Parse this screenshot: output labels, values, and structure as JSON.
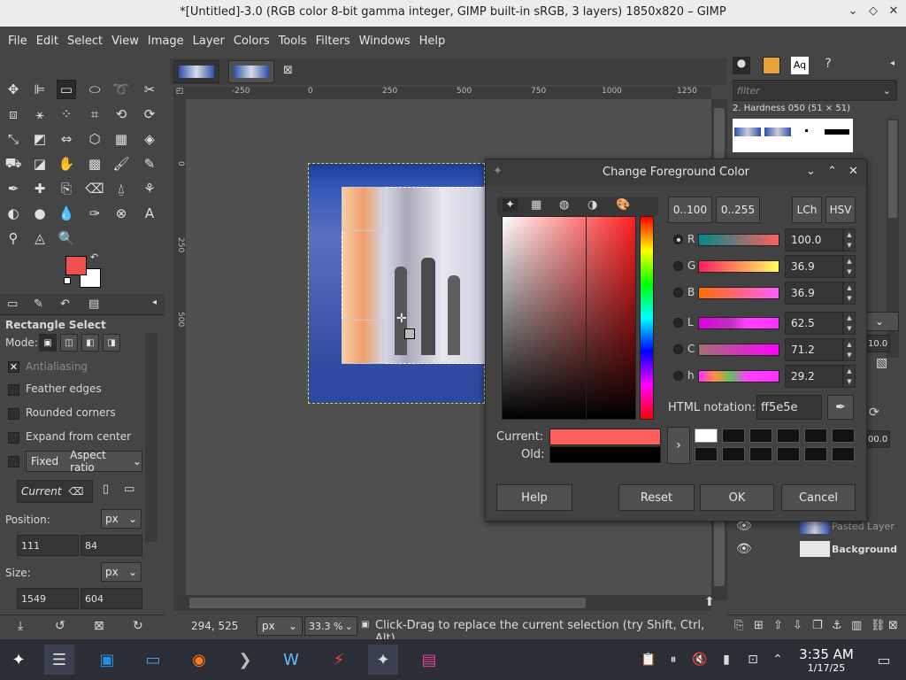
{
  "window": {
    "title": "*[Untitled]-3.0 (RGB color 8-bit gamma integer, GIMP built-in sRGB, 3 layers) 1850x820 – GIMP"
  },
  "menu": [
    "File",
    "Edit",
    "Select",
    "View",
    "Image",
    "Layer",
    "Colors",
    "Tools",
    "Filters",
    "Windows",
    "Help"
  ],
  "tool_options": {
    "title": "Rectangle Select",
    "mode_label": "Mode:",
    "antialiasing": "Antialiasing",
    "feather_edges": "Feather edges",
    "rounded_corners": "Rounded corners",
    "expand_from_center": "Expand from center",
    "fixed_label": "Fixed",
    "fixed_value": "Aspect ratio",
    "current_value": "Current",
    "position_label": "Position:",
    "position_unit": "px",
    "pos_x": "111",
    "pos_y": "84",
    "size_label": "Size:",
    "size_unit": "px",
    "size_w": "1549",
    "size_h": "604"
  },
  "canvas": {
    "ruler_marks": [
      "-250",
      "0",
      "250",
      "500",
      "750",
      "1000",
      "1250"
    ],
    "ruler_left": [
      "0",
      "250",
      "500"
    ],
    "coords": "294, 525",
    "unit": "px",
    "zoom": "33.3 %",
    "status": "Click-Drag to replace the current selection (try Shift, Ctrl, Alt)"
  },
  "right_dock": {
    "filter_placeholder": "filter",
    "brush_name": "2. Hardness 050 (51 × 51)",
    "text_tab": "Aq",
    "spin_value_1": "10.0",
    "spin_value_2": "00.0",
    "layers": [
      {
        "name": "Pasted Layer"
      },
      {
        "name": "Background"
      }
    ]
  },
  "dialog": {
    "title": "Change Foreground Color",
    "range_buttons": [
      "0..100",
      "0..255"
    ],
    "model_buttons": [
      "LCh",
      "HSV"
    ],
    "channels": [
      {
        "label": "R",
        "value": "100.0"
      },
      {
        "label": "G",
        "value": "36.9"
      },
      {
        "label": "B",
        "value": "36.9"
      },
      {
        "label": "L",
        "value": "62.5"
      },
      {
        "label": "C",
        "value": "71.2"
      },
      {
        "label": "h",
        "value": "29.2"
      }
    ],
    "html_label": "HTML notation:",
    "html_value": "ff5e5e",
    "current_label": "Current:",
    "old_label": "Old:",
    "current_color": "#ff5e5e",
    "old_color": "#000000",
    "buttons": {
      "help": "Help",
      "reset": "Reset",
      "ok": "OK",
      "cancel": "Cancel"
    }
  },
  "taskbar": {
    "time": "3:35 AM",
    "date": "1/17/25"
  },
  "colors": {
    "foreground": "#f05050",
    "background": "#ffffff",
    "accent_red": "#ff5e5e"
  }
}
